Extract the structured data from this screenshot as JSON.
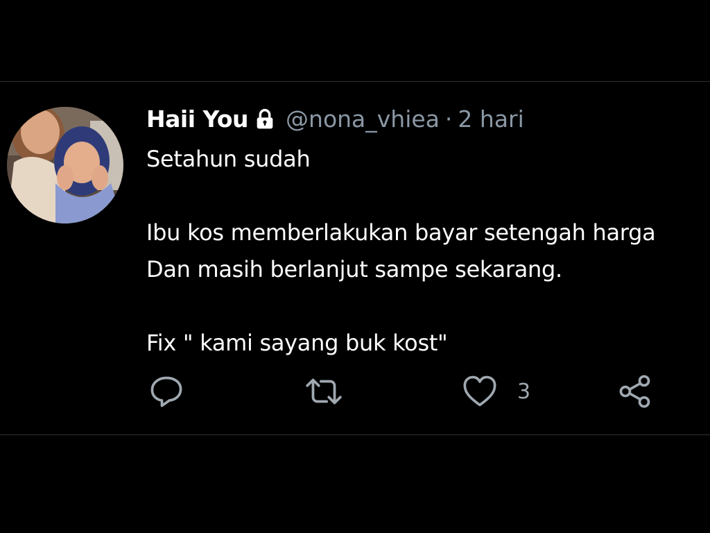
{
  "tweet": {
    "display_name": "Haii You",
    "protected": true,
    "handle": "@nona_vhiea",
    "separator": "·",
    "time": "2 hari",
    "lines": [
      "Setahun sudah",
      "",
      "Ibu kos memberlakukan bayar setengah harga",
      "Dan masih berlanjut sampe sekarang.",
      "",
      "Fix \" kami sayang buk kost\""
    ]
  },
  "actions": {
    "reply_icon": "reply-icon",
    "retweet_icon": "retweet-icon",
    "like_icon": "heart-icon",
    "like_count": "3",
    "share_icon": "share-icon"
  },
  "colors": {
    "background": "#000000",
    "text": "#ffffff",
    "secondary_text": "#8b98a5",
    "icon": "#a0a8b0",
    "divider": "#2f3336"
  }
}
